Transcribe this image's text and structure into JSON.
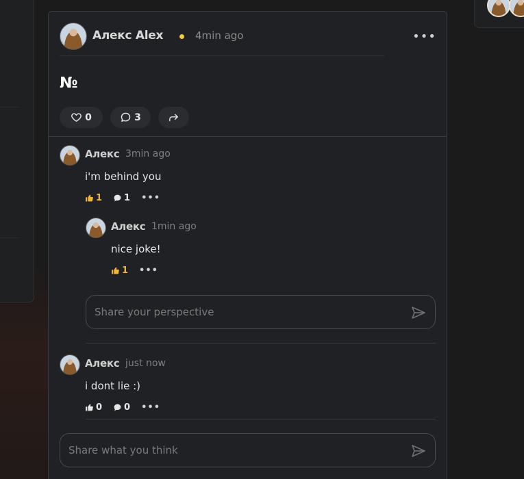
{
  "post": {
    "author": "Алекс Alex",
    "time": "4min ago",
    "body": "№",
    "likes": "0",
    "comments": "3"
  },
  "comments": [
    {
      "author": "Алекс",
      "time": "3min ago",
      "text": "i'm behind you",
      "likes": "1",
      "replies": "1",
      "reply": {
        "author": "Алекс",
        "time": "1min ago",
        "text": "nice joke!",
        "likes": "1"
      },
      "reply_placeholder": "Share your perspective"
    },
    {
      "author": "Алекс",
      "time": "just now",
      "text": "i dont lie :)",
      "likes": "0",
      "replies": "0"
    }
  ],
  "comment_input": {
    "placeholder": "Share what you think"
  },
  "icons": {
    "like": "heart-icon",
    "comment": "comment-bubble-icon",
    "share": "share-arrow-icon",
    "thumb": "thumbs-up-icon",
    "send": "send-icon",
    "more": "more-dots-icon"
  },
  "colors": {
    "accent": "#f0b43a",
    "status_dot": "#f0c74a",
    "card_bg": "#202124"
  }
}
